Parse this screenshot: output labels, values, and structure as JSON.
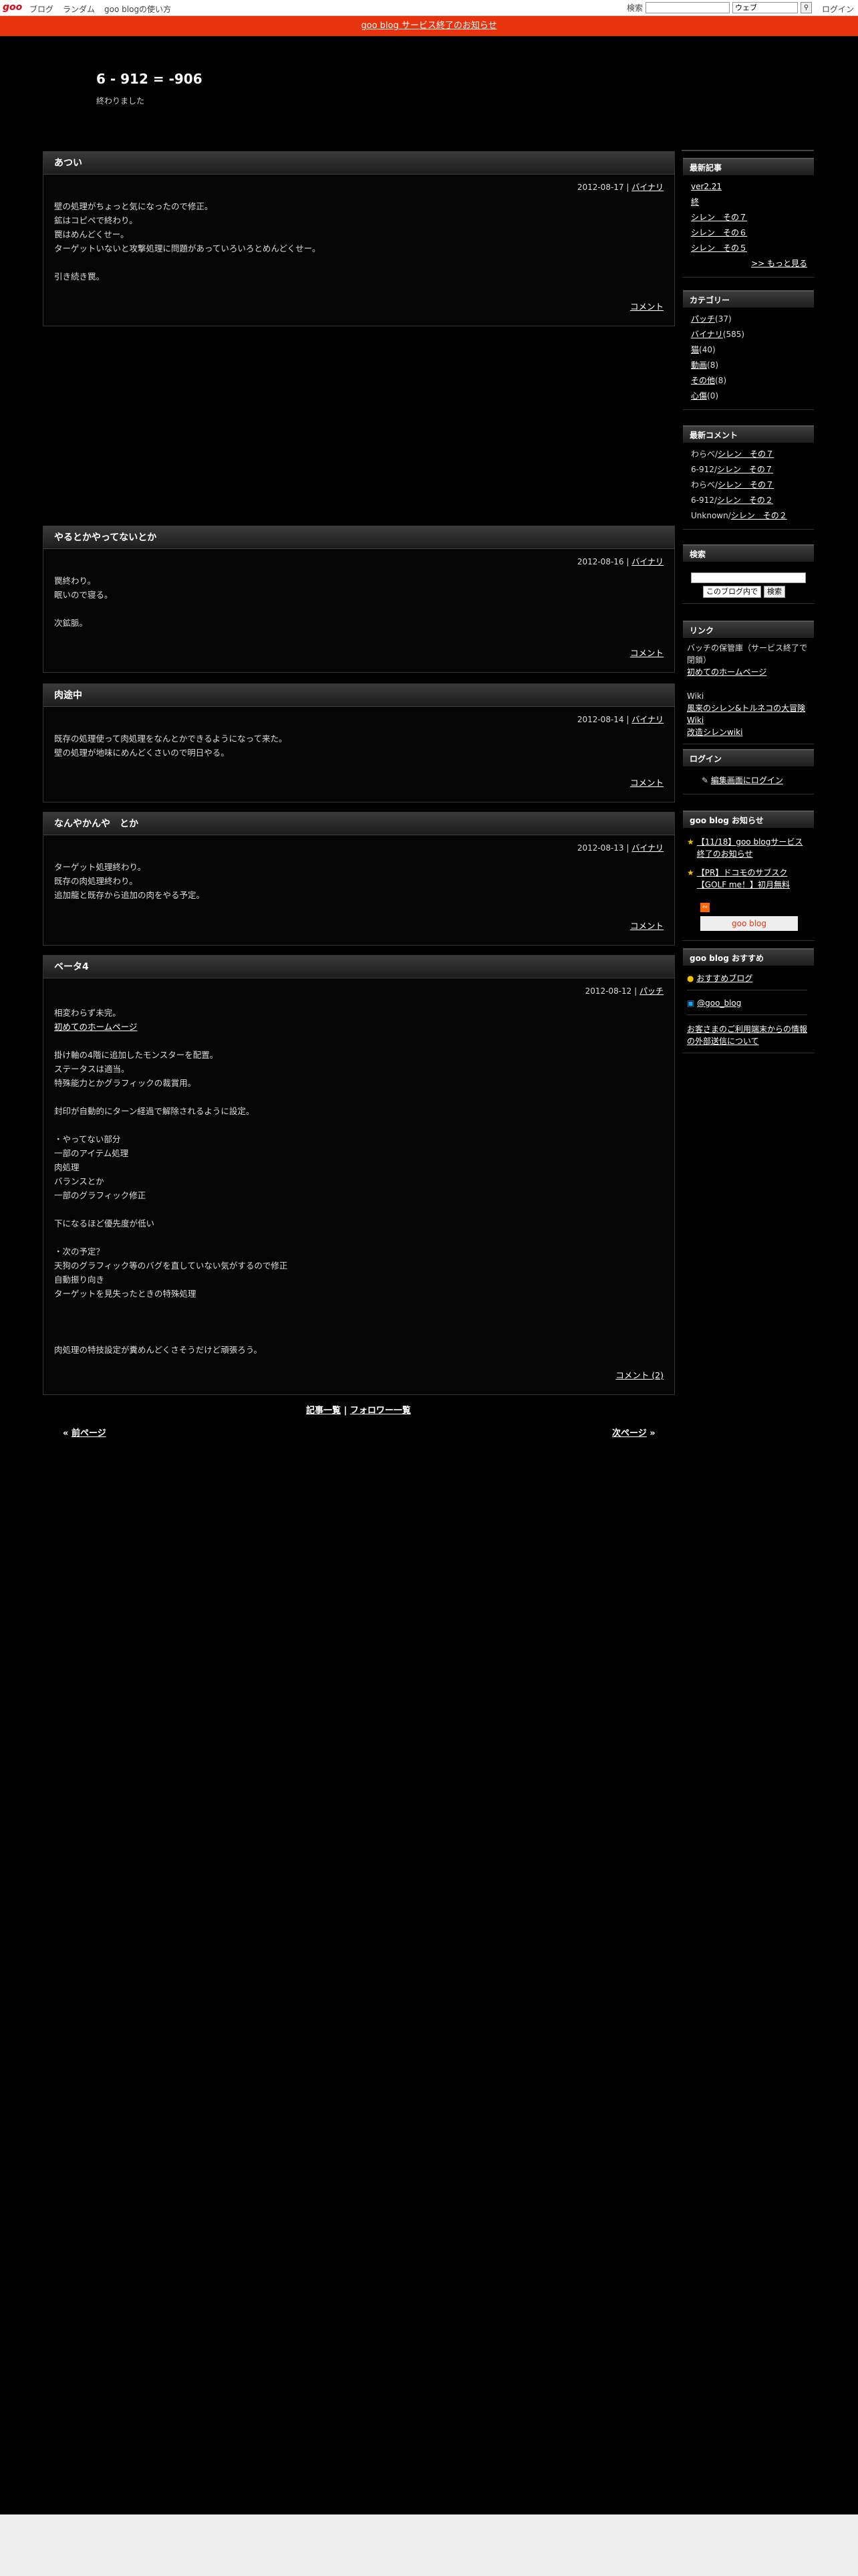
{
  "topbar": {
    "logo": "goo",
    "nav": [
      "ブログ",
      "ランダム",
      "goo blogの使い方"
    ],
    "search_label": "検索",
    "search_select": "ウェブ",
    "search_button_icon": "search-icon",
    "login": "ログイン"
  },
  "notice": "goo blog サービス終了のお知らせ",
  "blog": {
    "title": "6 - 912 = -906",
    "desc": "終わりました"
  },
  "posts": [
    {
      "title": "あつい",
      "date": "2012-08-17",
      "category": "バイナリ",
      "lines": [
        "壁の処理がちょっと気になったので修正。",
        "鉱はコピペで終わり。",
        "罠はめんどくせー。",
        "ターゲットいないと攻撃処理に問題があっていろいろとめんどくせー。",
        "",
        "引き続き罠。"
      ],
      "footer": "コメント"
    },
    {
      "title": "やるとかやってないとか",
      "date": "2012-08-16",
      "category": "バイナリ",
      "lines": [
        "罠終わり。",
        "眠いので寝る。",
        "",
        "次鉱脈。"
      ],
      "footer": "コメント"
    },
    {
      "title": "肉途中",
      "date": "2012-08-14",
      "category": "バイナリ",
      "lines": [
        "既存の処理使って肉処理をなんとかできるようになって来た。",
        "壁の処理が地味にめんどくさいので明日やる。"
      ],
      "footer": "コメント"
    },
    {
      "title": "なんやかんや　とか",
      "date": "2012-08-13",
      "category": "バイナリ",
      "lines": [
        "ターゲット処理終わり。",
        "既存の肉処理終わり。",
        "追加龍と既存から追加の肉をやる予定。"
      ],
      "footer": "コメント"
    },
    {
      "title": "ベータ4",
      "date": "2012-08-12",
      "category": "パッチ",
      "lines": [
        "相変わらず未完。"
      ],
      "link": "初めてのホームページ",
      "lines2": [
        "",
        "掛け軸の4階に追加したモンスターを配置。",
        "ステータスは適当。",
        "特殊能力とかグラフィックの裁賞用。",
        "",
        "封印が自動的にターン経過で解除されるように設定。",
        "",
        "・やってない部分",
        "一部のアイテム処理",
        "肉処理",
        "バランスとか",
        "一部のグラフィック修正",
        "",
        "下になるほど優先度が低い",
        "",
        "・次の予定？",
        "天狗のグラフィック等のバグを直していない気がするので修正",
        "自動振り向き",
        "ターゲットを見失ったときの特殊処理",
        "",
        "",
        "",
        "肉処理の特技設定が糞めんどくさそうだけど頑張ろう。"
      ],
      "footer": "コメント (2)"
    }
  ],
  "links_bar": {
    "articles": "記事一覧",
    "sep": "|",
    "followers": "フォロワー一覧"
  },
  "pager": {
    "prev": "前ページ",
    "next": "次ページ",
    "prev_arrow": "«",
    "next_arrow": "»"
  },
  "sidebar": {
    "recent": {
      "title": "最新記事",
      "items": [
        "ver2.21",
        "終",
        "シレン　その７",
        "シレン　その６",
        "シレン　その５"
      ],
      "more": ">> もっと見る"
    },
    "categories": {
      "title": "カテゴリー",
      "items": [
        {
          "name": "パッチ",
          "count": "(37)"
        },
        {
          "name": "バイナリ",
          "count": "(585)"
        },
        {
          "name": "猫",
          "count": "(40)"
        },
        {
          "name": "動画",
          "count": "(8)"
        },
        {
          "name": "その他",
          "count": "(8)"
        },
        {
          "name": "心傷",
          "count": "(0)"
        }
      ]
    },
    "comments": {
      "title": "最新コメント",
      "items": [
        {
          "who": "わらべ/",
          "what": "シレン　その７"
        },
        {
          "who": "6-912/",
          "what": "シレン　その７"
        },
        {
          "who": "わらべ/",
          "what": "シレン　その７"
        },
        {
          "who": "6-912/",
          "what": "シレン　その２"
        },
        {
          "who": "Unknown/",
          "what": "シレン　その２"
        }
      ]
    },
    "search": {
      "title": "検索",
      "scope": "このブログ内で",
      "button": "検索"
    },
    "links": {
      "title": "リンク",
      "text1": "バッチの保管庫（サービス終了で閉鎖）",
      "link1": "初めてのホームページ",
      "text2": "Wiki",
      "link2": "風来のシレン&トルネコの大冒険 Wiki",
      "link3": "改造シレンwiki"
    },
    "login": {
      "title": "ログイン",
      "link": "編集画面にログイン"
    },
    "notice": {
      "title": "goo blog お知らせ",
      "items": [
        "【11/18】goo blogサービス終了のお知らせ",
        "【PR】ドコモのサブスク【GOLF me！】初月無料"
      ],
      "rss_icon": "rss-icon",
      "badge": "goo blog"
    },
    "recommend": {
      "title": "goo blog おすすめ",
      "item1": "おすすめブログ",
      "item2": "@goo_blog",
      "item3": "お客さまのご利用端末からの情報の外部送信について"
    }
  }
}
